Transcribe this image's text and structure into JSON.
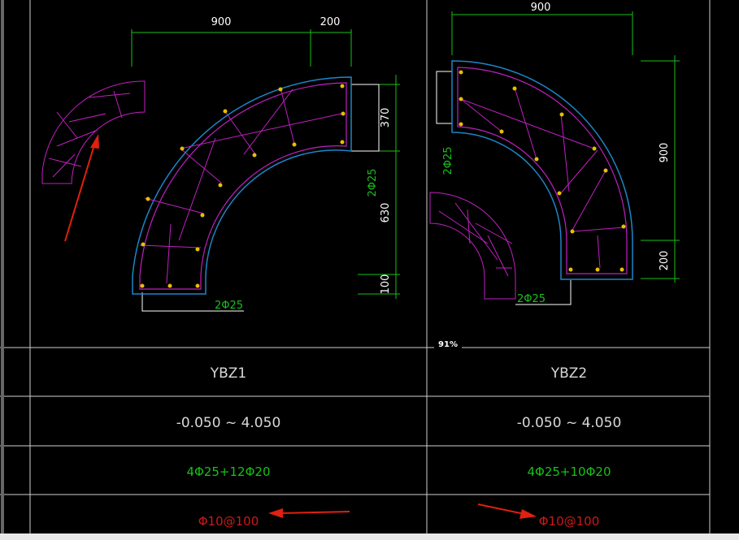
{
  "viewport": {
    "zoom_label": "91%"
  },
  "drawing": {
    "ybz1": {
      "dim_top_1": "900",
      "dim_top_2": "200",
      "dim_right_1": "370",
      "dim_right_2": "630",
      "dim_right_3": "100",
      "rebar_label_side": "2Φ25",
      "rebar_label_bottom": "2Φ25"
    },
    "ybz2": {
      "dim_top_1": "900",
      "dim_right_1": "900",
      "dim_right_2": "200",
      "rebar_label_side": "2Φ25",
      "rebar_label_bottom": "2Φ25"
    }
  },
  "table": {
    "columns": [
      {
        "name": "YBZ1",
        "elevation": "-0.050 ~ 4.050",
        "longitudinal": "4Φ25+12Φ20",
        "stirrup": "Φ10@100"
      },
      {
        "name": "YBZ2",
        "elevation": "-0.050 ~ 4.050",
        "longitudinal": "4Φ25+10Φ20",
        "stirrup": "Φ10@100"
      }
    ]
  },
  "colors": {
    "background": "#000000",
    "outline_cyan": "#1c86c8",
    "rebar_magenta": "#c020c0",
    "dimension_green": "#18c018",
    "grid_white": "#cfcfcf",
    "arrow_red": "#e02010"
  }
}
